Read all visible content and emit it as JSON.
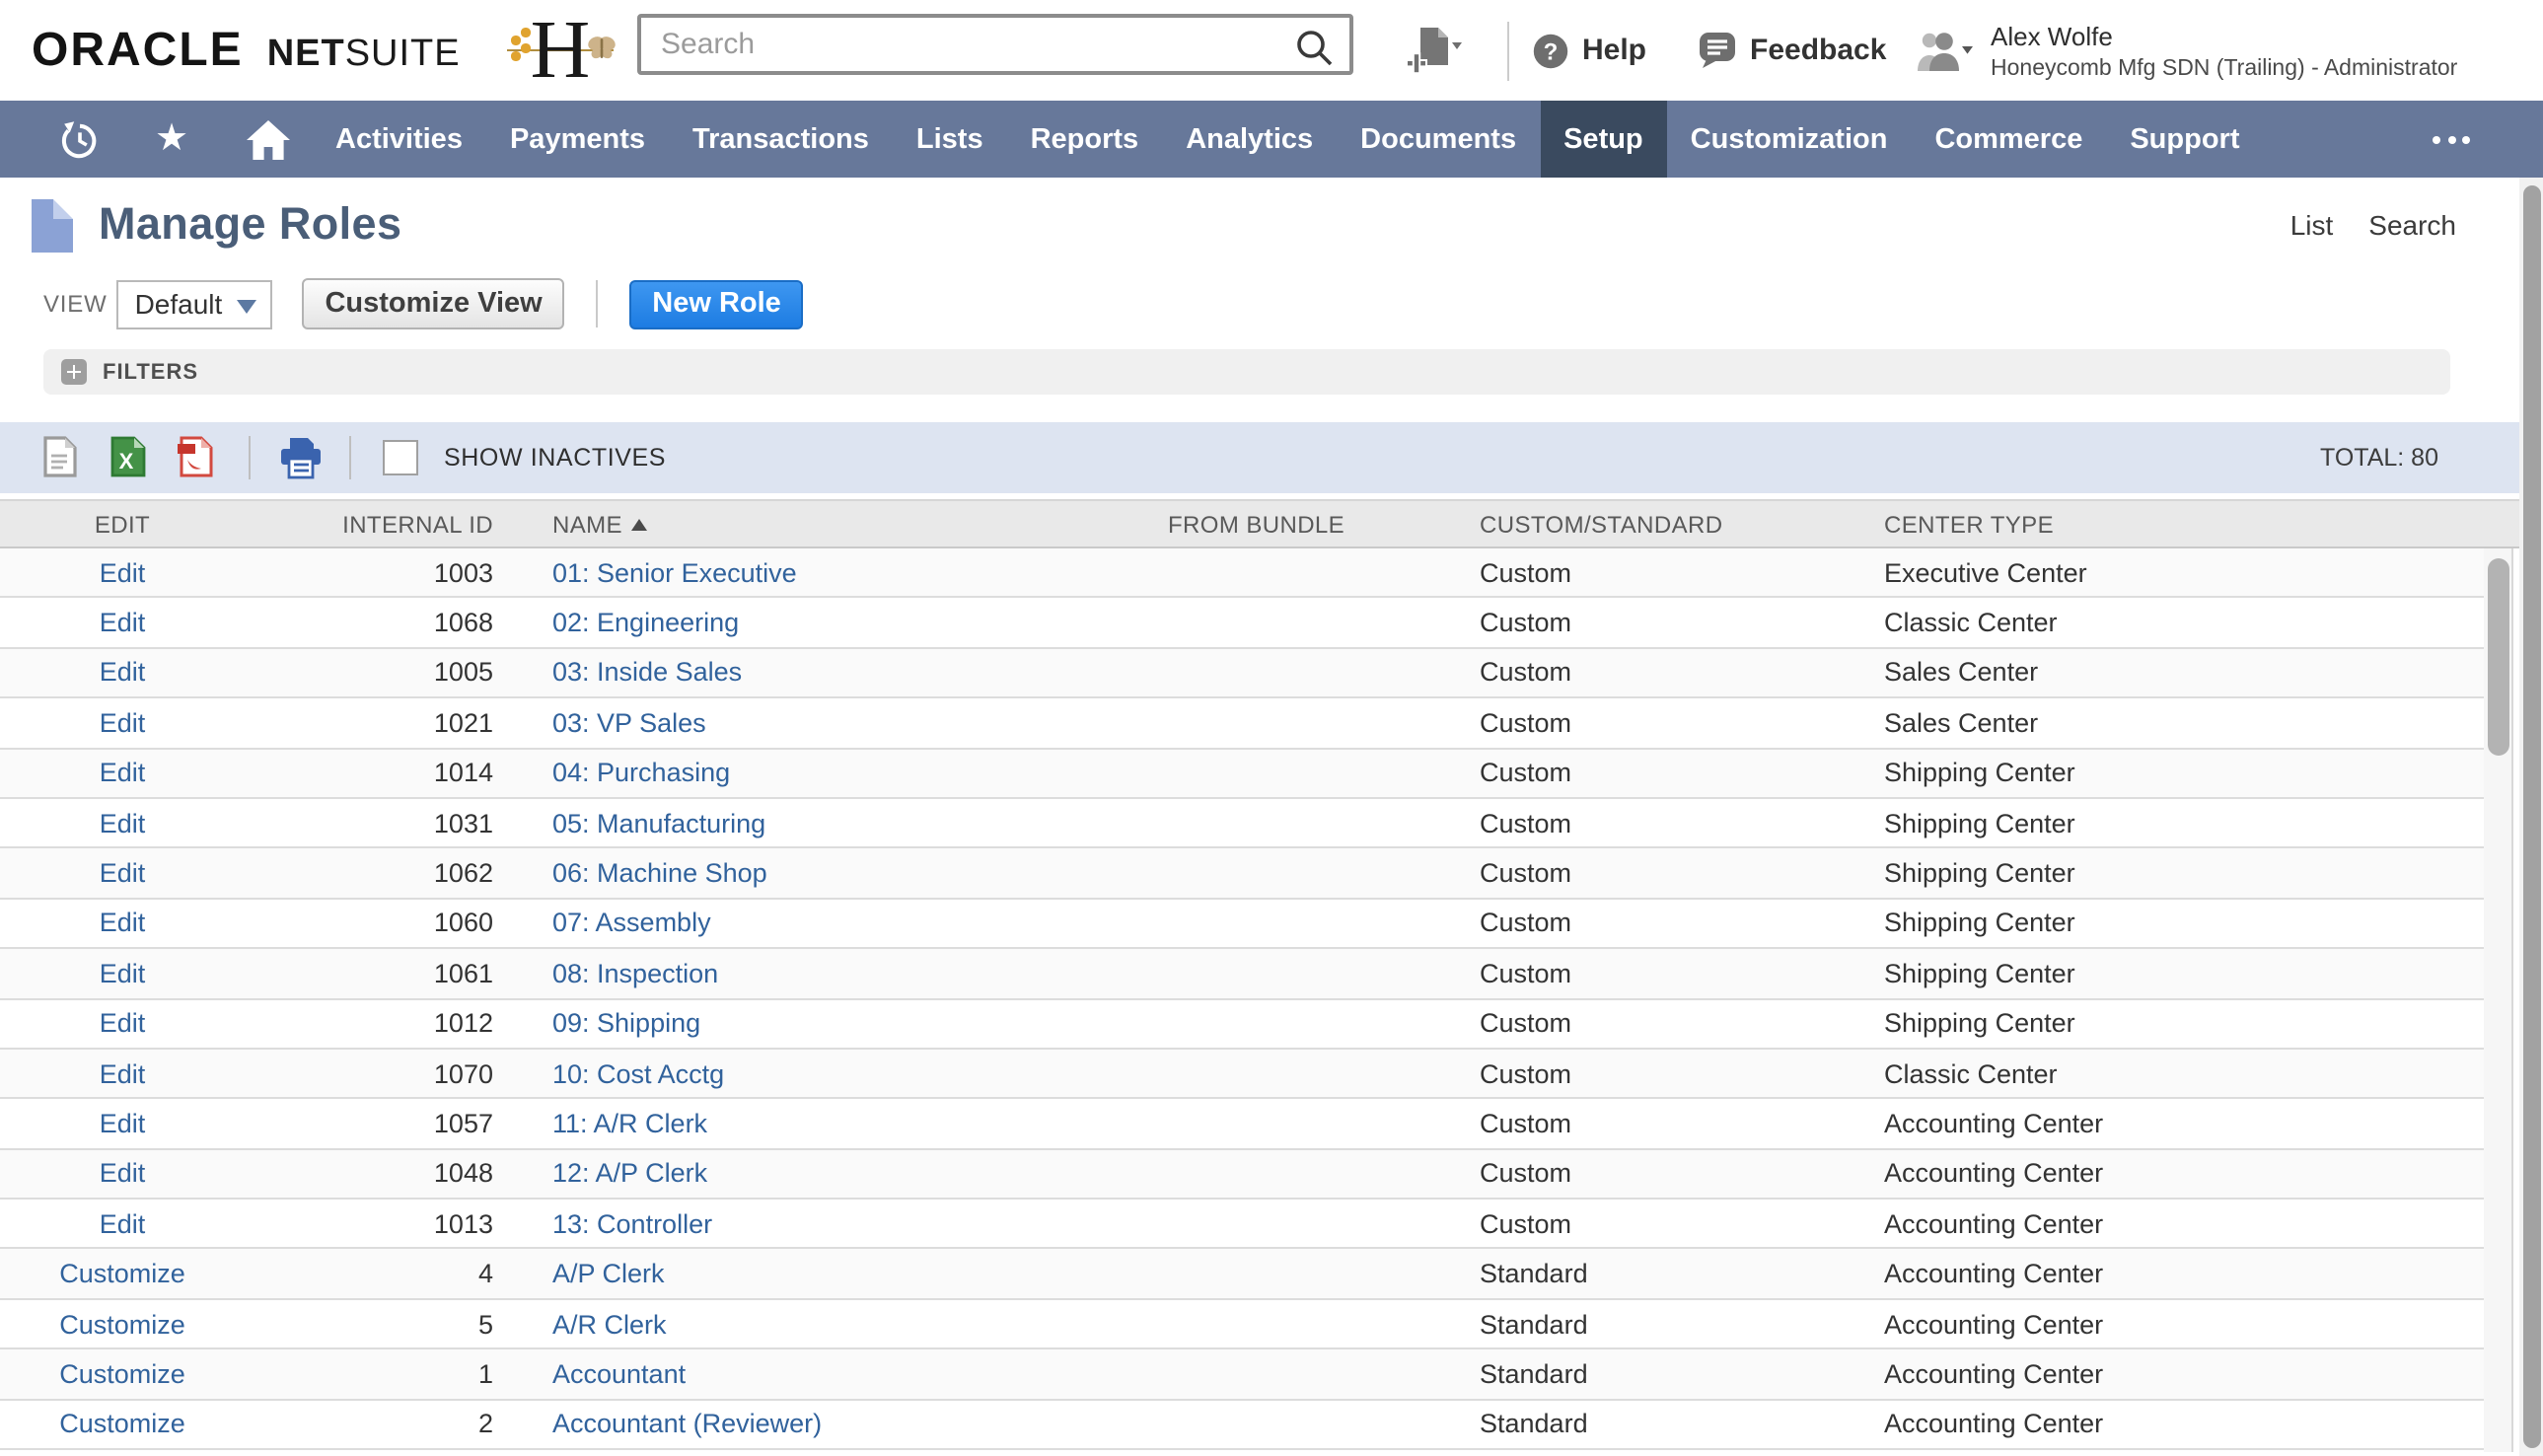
{
  "colors": {
    "nav_bg": "#67789a",
    "nav_active": "#3a4a5f",
    "toolbar_bg": "#dde4f1",
    "link": "#31629c",
    "title": "#4a5e78"
  },
  "header": {
    "logo_oracle": "ORACLE",
    "logo_net": "NET",
    "logo_suite": "SUITE",
    "search_placeholder": "Search",
    "help_label": "Help",
    "feedback_label": "Feedback",
    "user_name": "Alex Wolfe",
    "user_company": "Honeycomb Mfg SDN (Trailing) - Administrator"
  },
  "nav": {
    "items": [
      "Activities",
      "Payments",
      "Transactions",
      "Lists",
      "Reports",
      "Analytics",
      "Documents",
      "Setup",
      "Customization",
      "Commerce",
      "Support"
    ],
    "active": "Setup"
  },
  "page": {
    "title": "Manage Roles",
    "list_link": "List",
    "search_link": "Search",
    "view_label": "VIEW",
    "view_value": "Default",
    "customize_view_label": "Customize View",
    "new_role_label": "New Role",
    "filters_label": "FILTERS",
    "show_inactives_label": "SHOW INACTIVES",
    "total_label": "TOTAL: 80"
  },
  "table": {
    "columns": [
      "EDIT",
      "INTERNAL ID",
      "NAME",
      "FROM BUNDLE",
      "CUSTOM/STANDARD",
      "CENTER TYPE"
    ],
    "sort_column": "NAME",
    "sort_direction": "ascending",
    "rows": [
      {
        "action": "Edit",
        "id": "1003",
        "name": "01: Senior Executive",
        "bundle": "",
        "type": "Custom",
        "center": "Executive Center"
      },
      {
        "action": "Edit",
        "id": "1068",
        "name": "02: Engineering",
        "bundle": "",
        "type": "Custom",
        "center": "Classic Center"
      },
      {
        "action": "Edit",
        "id": "1005",
        "name": "03: Inside Sales",
        "bundle": "",
        "type": "Custom",
        "center": "Sales Center"
      },
      {
        "action": "Edit",
        "id": "1021",
        "name": "03: VP Sales",
        "bundle": "",
        "type": "Custom",
        "center": "Sales Center"
      },
      {
        "action": "Edit",
        "id": "1014",
        "name": "04: Purchasing",
        "bundle": "",
        "type": "Custom",
        "center": "Shipping Center"
      },
      {
        "action": "Edit",
        "id": "1031",
        "name": "05: Manufacturing",
        "bundle": "",
        "type": "Custom",
        "center": "Shipping Center"
      },
      {
        "action": "Edit",
        "id": "1062",
        "name": "06: Machine Shop",
        "bundle": "",
        "type": "Custom",
        "center": "Shipping Center"
      },
      {
        "action": "Edit",
        "id": "1060",
        "name": "07: Assembly",
        "bundle": "",
        "type": "Custom",
        "center": "Shipping Center"
      },
      {
        "action": "Edit",
        "id": "1061",
        "name": "08: Inspection",
        "bundle": "",
        "type": "Custom",
        "center": "Shipping Center"
      },
      {
        "action": "Edit",
        "id": "1012",
        "name": "09: Shipping",
        "bundle": "",
        "type": "Custom",
        "center": "Shipping Center"
      },
      {
        "action": "Edit",
        "id": "1070",
        "name": "10: Cost Acctg",
        "bundle": "",
        "type": "Custom",
        "center": "Classic Center"
      },
      {
        "action": "Edit",
        "id": "1057",
        "name": "11: A/R Clerk",
        "bundle": "",
        "type": "Custom",
        "center": "Accounting Center"
      },
      {
        "action": "Edit",
        "id": "1048",
        "name": "12: A/P Clerk",
        "bundle": "",
        "type": "Custom",
        "center": "Accounting Center"
      },
      {
        "action": "Edit",
        "id": "1013",
        "name": "13: Controller",
        "bundle": "",
        "type": "Custom",
        "center": "Accounting Center"
      },
      {
        "action": "Customize",
        "id": "4",
        "name": "A/P Clerk",
        "bundle": "",
        "type": "Standard",
        "center": "Accounting Center"
      },
      {
        "action": "Customize",
        "id": "5",
        "name": "A/R Clerk",
        "bundle": "",
        "type": "Standard",
        "center": "Accounting Center"
      },
      {
        "action": "Customize",
        "id": "1",
        "name": "Accountant",
        "bundle": "",
        "type": "Standard",
        "center": "Accounting Center"
      },
      {
        "action": "Customize",
        "id": "2",
        "name": "Accountant (Reviewer)",
        "bundle": "",
        "type": "Standard",
        "center": "Accounting Center"
      }
    ]
  }
}
